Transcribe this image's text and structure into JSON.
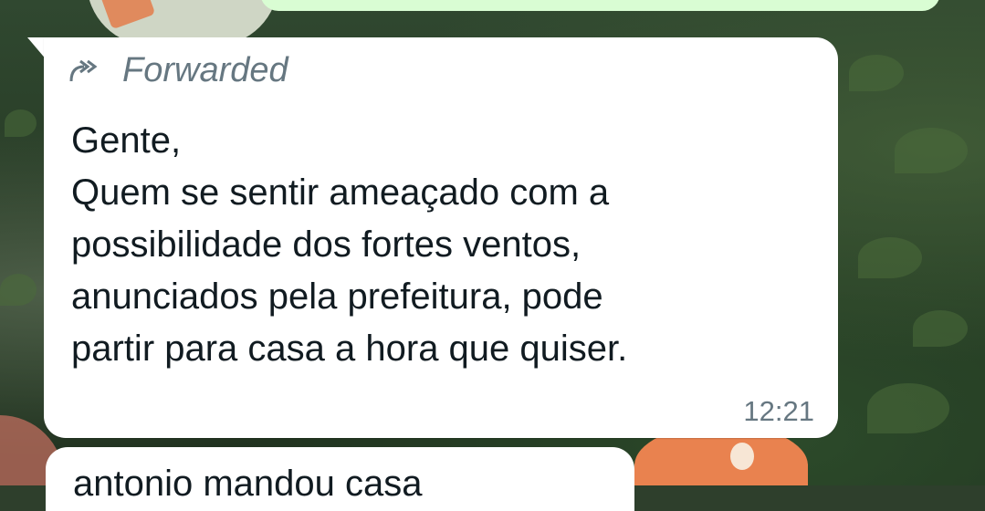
{
  "colors": {
    "incoming_bubble": "#ffffff",
    "outgoing_bubble": "#d9fdd3",
    "meta_text": "#667781",
    "message_text": "#111b21"
  },
  "message": {
    "forwarded_icon": "forwarded-arrow-icon",
    "forwarded_label": "Forwarded",
    "lines": [
      "Gente,",
      "Quem se sentir ameaçado com a",
      "possibilidade dos fortes ventos,",
      "anunciados pela prefeitura, pode",
      "partir para casa a hora que quiser."
    ],
    "time": "12:21"
  },
  "next_message": {
    "partial_text": "antonio mandou casa"
  }
}
